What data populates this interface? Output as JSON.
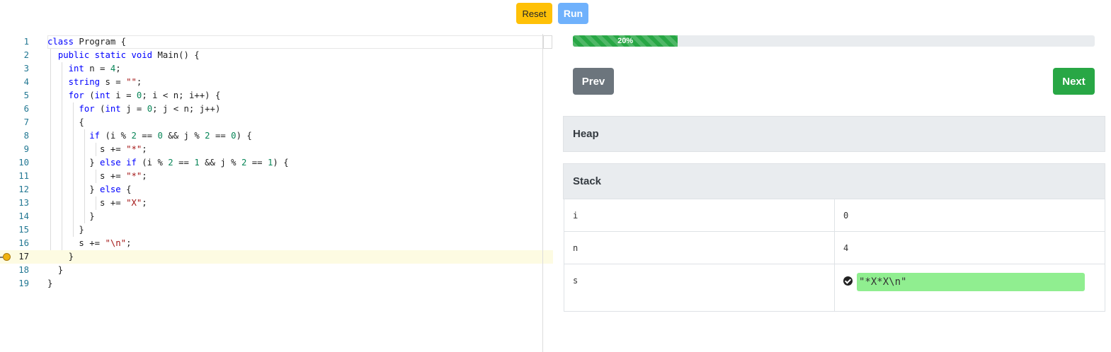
{
  "toolbar": {
    "reset_label": "Reset",
    "run_label": "Run"
  },
  "editor": {
    "current_line": 17,
    "lines": [
      {
        "n": "1",
        "segs": [
          [
            "kw",
            "class"
          ],
          [
            "p",
            " Program {"
          ]
        ]
      },
      {
        "n": "2",
        "segs": [
          [
            "p",
            "  "
          ],
          [
            "kw",
            "public static void"
          ],
          [
            "p",
            " Main() {"
          ]
        ]
      },
      {
        "n": "3",
        "segs": [
          [
            "p",
            "    "
          ],
          [
            "kw",
            "int"
          ],
          [
            "p",
            " n = "
          ],
          [
            "num",
            "4"
          ],
          [
            "p",
            ";"
          ]
        ]
      },
      {
        "n": "4",
        "segs": [
          [
            "p",
            "    "
          ],
          [
            "kw",
            "string"
          ],
          [
            "p",
            " s = "
          ],
          [
            "str",
            "\"\""
          ],
          [
            "p",
            ";"
          ]
        ]
      },
      {
        "n": "5",
        "segs": [
          [
            "p",
            "    "
          ],
          [
            "kw",
            "for"
          ],
          [
            "p",
            " ("
          ],
          [
            "kw",
            "int"
          ],
          [
            "p",
            " i = "
          ],
          [
            "num",
            "0"
          ],
          [
            "p",
            "; i < n; i++) {"
          ]
        ]
      },
      {
        "n": "6",
        "segs": [
          [
            "p",
            "      "
          ],
          [
            "kw",
            "for"
          ],
          [
            "p",
            " ("
          ],
          [
            "kw",
            "int"
          ],
          [
            "p",
            " j = "
          ],
          [
            "num",
            "0"
          ],
          [
            "p",
            "; j < n; j++)"
          ]
        ]
      },
      {
        "n": "7",
        "segs": [
          [
            "p",
            "      {"
          ]
        ]
      },
      {
        "n": "8",
        "segs": [
          [
            "p",
            "        "
          ],
          [
            "kw",
            "if"
          ],
          [
            "p",
            " (i % "
          ],
          [
            "num",
            "2"
          ],
          [
            "p",
            " == "
          ],
          [
            "num",
            "0"
          ],
          [
            "p",
            " && j % "
          ],
          [
            "num",
            "2"
          ],
          [
            "p",
            " == "
          ],
          [
            "num",
            "0"
          ],
          [
            "p",
            ") {"
          ]
        ]
      },
      {
        "n": "9",
        "segs": [
          [
            "p",
            "          s += "
          ],
          [
            "str",
            "\"*\""
          ],
          [
            "p",
            ";"
          ]
        ]
      },
      {
        "n": "10",
        "segs": [
          [
            "p",
            "        } "
          ],
          [
            "kw",
            "else if"
          ],
          [
            "p",
            " (i % "
          ],
          [
            "num",
            "2"
          ],
          [
            "p",
            " == "
          ],
          [
            "num",
            "1"
          ],
          [
            "p",
            " && j % "
          ],
          [
            "num",
            "2"
          ],
          [
            "p",
            " == "
          ],
          [
            "num",
            "1"
          ],
          [
            "p",
            ") {"
          ]
        ]
      },
      {
        "n": "11",
        "segs": [
          [
            "p",
            "          s += "
          ],
          [
            "str",
            "\"*\""
          ],
          [
            "p",
            ";"
          ]
        ]
      },
      {
        "n": "12",
        "segs": [
          [
            "p",
            "        } "
          ],
          [
            "kw",
            "else"
          ],
          [
            "p",
            " {"
          ]
        ]
      },
      {
        "n": "13",
        "segs": [
          [
            "p",
            "          s += "
          ],
          [
            "str",
            "\"X\""
          ],
          [
            "p",
            ";"
          ]
        ]
      },
      {
        "n": "14",
        "segs": [
          [
            "p",
            "        }"
          ]
        ]
      },
      {
        "n": "15",
        "segs": [
          [
            "p",
            "      }"
          ]
        ]
      },
      {
        "n": "16",
        "segs": [
          [
            "p",
            "      s += "
          ],
          [
            "str",
            "\"\\n\""
          ],
          [
            "p",
            ";"
          ]
        ]
      },
      {
        "n": "17",
        "segs": [
          [
            "p",
            "    }"
          ]
        ]
      },
      {
        "n": "18",
        "segs": [
          [
            "p",
            "  }"
          ]
        ]
      },
      {
        "n": "19",
        "segs": [
          [
            "p",
            "}"
          ]
        ]
      }
    ]
  },
  "progress": {
    "value": 0.2,
    "label": "20%"
  },
  "nav": {
    "prev_label": "Prev",
    "next_label": "Next"
  },
  "heap": {
    "title": "Heap"
  },
  "stack": {
    "title": "Stack",
    "rows": [
      {
        "name": "i",
        "value": "0"
      },
      {
        "name": "n",
        "value": "4"
      },
      {
        "name": "s",
        "value": "\"*X*X\\n\""
      }
    ]
  },
  "colors": {
    "reset": "#ffc107",
    "run": "#6fb1fc",
    "progress": "#28a745",
    "prev": "#6c757d",
    "next": "#28a745",
    "changed_value": "#90ee90",
    "breakpoint": "#f0b30e"
  }
}
